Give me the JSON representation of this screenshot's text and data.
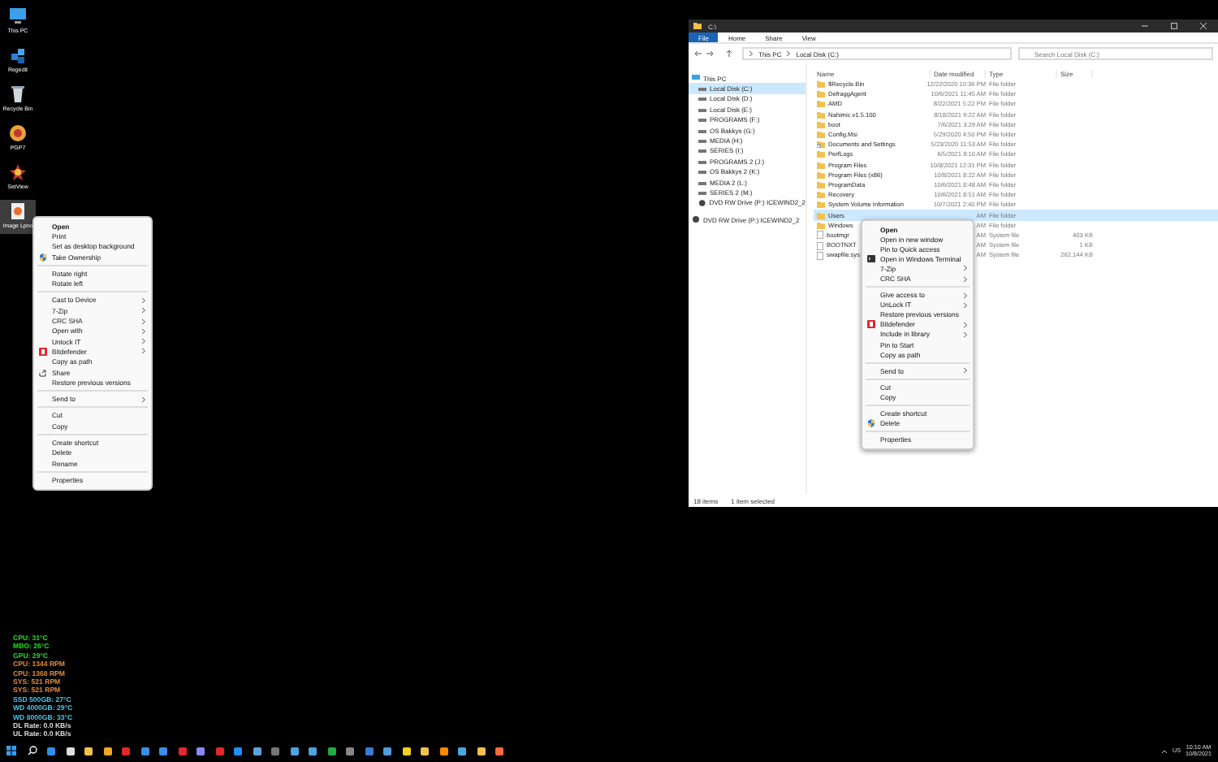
{
  "desktop_icons": [
    {
      "label": "This PC",
      "kind": "pc",
      "selected": false
    },
    {
      "label": "Regedit",
      "kind": "regedit",
      "selected": false
    },
    {
      "label": "Recycle Bin",
      "kind": "bin",
      "selected": false
    },
    {
      "label": "PGP7",
      "kind": "app",
      "selected": false
    },
    {
      "label": "SetView",
      "kind": "app2",
      "selected": false
    },
    {
      "label": "Image Lpno",
      "kind": "image",
      "selected": true
    }
  ],
  "desktop_menu": [
    {
      "kind": "item",
      "label": "Open",
      "bold": true
    },
    {
      "kind": "item",
      "label": "Print"
    },
    {
      "kind": "item",
      "label": "Set as desktop background"
    },
    {
      "kind": "item",
      "label": "Take Ownership"
    },
    {
      "kind": "separator"
    },
    {
      "kind": "item",
      "label": "Rotate right"
    },
    {
      "kind": "item",
      "label": "Rotate left"
    },
    {
      "kind": "separator"
    },
    {
      "kind": "item",
      "label": "Cast to Device",
      "submenu": true
    },
    {
      "kind": "item",
      "label": "7-Zip",
      "submenu": true
    },
    {
      "kind": "item",
      "label": "CRC SHA",
      "submenu": true
    },
    {
      "kind": "item",
      "label": "Open with",
      "submenu": true
    },
    {
      "kind": "item",
      "label": "Unlock IT",
      "submenu": true
    },
    {
      "kind": "item",
      "label": "Bitdefender",
      "submenu": true
    },
    {
      "kind": "item",
      "label": "Copy as path"
    },
    {
      "kind": "item",
      "label": "Share"
    },
    {
      "kind": "item",
      "label": "Restore previous versions"
    },
    {
      "kind": "separator"
    },
    {
      "kind": "item",
      "label": "Send to",
      "submenu": true
    },
    {
      "kind": "separator"
    },
    {
      "kind": "item",
      "label": "Cut"
    },
    {
      "kind": "item",
      "label": "Copy"
    },
    {
      "kind": "separator"
    },
    {
      "kind": "item",
      "label": "Create shortcut"
    },
    {
      "kind": "item",
      "label": "Delete"
    },
    {
      "kind": "item",
      "label": "Rename"
    },
    {
      "kind": "separator"
    },
    {
      "kind": "item",
      "label": "Properties"
    }
  ],
  "explorer": {
    "title": "C:\\",
    "ribbon_tabs": [
      {
        "label": "File",
        "selected": true
      },
      {
        "label": "Home",
        "selected": false
      },
      {
        "label": "Share",
        "selected": false
      },
      {
        "label": "View",
        "selected": false
      }
    ],
    "address": [
      "This PC",
      "Local Disk (C:)"
    ],
    "search": {
      "placeholder": "Search Local Disk (C:)"
    },
    "nav": [
      {
        "label": "This PC",
        "kind": "pc",
        "selected": false,
        "children": [
          {
            "label": "Local Disk (C:)",
            "kind": "drive",
            "selected": true
          },
          {
            "label": "Local Disk (D:)",
            "kind": "drive",
            "selected": false
          },
          {
            "label": "Local Disk (E:)",
            "kind": "drive",
            "selected": false
          },
          {
            "label": "PROGRAMS (F:)",
            "kind": "drive",
            "selected": false
          },
          {
            "label": "OS Bakkys (G:)",
            "kind": "drive",
            "selected": false
          },
          {
            "label": "MEDIA (H:)",
            "kind": "drive",
            "selected": false
          },
          {
            "label": "SERIES (I:)",
            "kind": "drive",
            "selected": false
          },
          {
            "label": "PROGRAMS 2 (J:)",
            "kind": "drive",
            "selected": false
          },
          {
            "label": "OS Bakkys 2 (K:)",
            "kind": "drive",
            "selected": false
          },
          {
            "label": "MEDIA 2 (L:)",
            "kind": "drive",
            "selected": false
          },
          {
            "label": "SERIES 2 (M:)",
            "kind": "drive",
            "selected": false
          },
          {
            "label": "DVD RW Drive (P:) ICEWIND2_2",
            "kind": "dvd",
            "selected": false
          }
        ]
      },
      {
        "label": "DVD RW Drive (P:) ICEWIND2_2",
        "kind": "dvd",
        "selected": false
      }
    ],
    "columns": [
      "Name",
      "Date modified",
      "Type",
      "Size"
    ],
    "rows": [
      {
        "kind": "folder",
        "selected": false,
        "cells": [
          "$Recycle.Bin",
          "12/22/2020 10:36 PM",
          "File folder",
          ""
        ]
      },
      {
        "kind": "folder",
        "selected": false,
        "cells": [
          "DefraggAgent",
          "10/6/2021 11:45 AM",
          "File folder",
          ""
        ]
      },
      {
        "kind": "folder",
        "selected": false,
        "cells": [
          "AMD",
          "8/22/2021 5:22 PM",
          "File folder",
          ""
        ]
      },
      {
        "kind": "folder",
        "selected": false,
        "cells": [
          "Nahimic v1.5.100",
          "8/18/2021 9:22 AM",
          "File folder",
          ""
        ]
      },
      {
        "kind": "folder",
        "selected": false,
        "cells": [
          "boot",
          "7/6/2021 3:29 AM",
          "File folder",
          ""
        ]
      },
      {
        "kind": "folder",
        "selected": false,
        "cells": [
          "Config.Msi",
          "5/29/2020 4:50 PM",
          "File folder",
          ""
        ]
      },
      {
        "kind": "link",
        "selected": false,
        "cells": [
          "Documents and Settings",
          "5/23/2020 11:53 AM",
          "File folder",
          ""
        ]
      },
      {
        "kind": "folder",
        "selected": false,
        "cells": [
          "PerfLogs",
          "6/5/2021 8:10 AM",
          "File folder",
          ""
        ]
      },
      {
        "kind": "folder",
        "selected": false,
        "cells": [
          "Program Files",
          "10/8/2021 12:31 PM",
          "File folder",
          ""
        ]
      },
      {
        "kind": "folder",
        "selected": false,
        "cells": [
          "Program Files (x86)",
          "10/8/2021 8:22 AM",
          "File folder",
          ""
        ]
      },
      {
        "kind": "folder",
        "selected": false,
        "cells": [
          "ProgramData",
          "10/6/2021 8:48 AM",
          "File folder",
          ""
        ]
      },
      {
        "kind": "folder",
        "selected": false,
        "cells": [
          "Recovery",
          "10/6/2021 8:51 AM",
          "File folder",
          ""
        ]
      },
      {
        "kind": "folder",
        "selected": false,
        "cells": [
          "System Volume Information",
          "10/7/2021 2:40 PM",
          "File folder",
          ""
        ]
      },
      {
        "kind": "folder",
        "selected": true,
        "cells": [
          "Users",
          "AM",
          "File folder",
          ""
        ]
      },
      {
        "kind": "folder",
        "selected": false,
        "cells": [
          "Windows",
          "AM",
          "File folder",
          ""
        ]
      },
      {
        "kind": "file",
        "selected": false,
        "cells": [
          "bootmgr",
          "AM",
          "System file",
          "403 KB"
        ]
      },
      {
        "kind": "file",
        "selected": false,
        "cells": [
          "BOOTNXT",
          "AM",
          "System file",
          "1 KB"
        ]
      },
      {
        "kind": "file",
        "selected": false,
        "cells": [
          "swapfile.sys",
          "AM",
          "System file",
          "262,144 KB"
        ]
      }
    ],
    "status": [
      "18 items",
      "1 item selected"
    ],
    "menu": [
      {
        "kind": "item",
        "label": "Open",
        "bold": true
      },
      {
        "kind": "item",
        "label": "Open in new window"
      },
      {
        "kind": "item",
        "label": "Pin to Quick access"
      },
      {
        "kind": "item",
        "label": "Open in Windows Terminal"
      },
      {
        "kind": "item",
        "label": "7-Zip",
        "submenu": true
      },
      {
        "kind": "item",
        "label": "CRC SHA",
        "submenu": true
      },
      {
        "kind": "separator"
      },
      {
        "kind": "item",
        "label": "Give access to",
        "submenu": true
      },
      {
        "kind": "item",
        "label": "UnLock IT",
        "submenu": true
      },
      {
        "kind": "item",
        "label": "Restore previous versions"
      },
      {
        "kind": "item",
        "label": "Bitdefender",
        "submenu": true
      },
      {
        "kind": "item",
        "label": "Include in library",
        "submenu": true
      },
      {
        "kind": "item",
        "label": "Pin to Start"
      },
      {
        "kind": "item",
        "label": "Copy as path"
      },
      {
        "kind": "separator"
      },
      {
        "kind": "item",
        "label": "Send to",
        "submenu": true
      },
      {
        "kind": "separator"
      },
      {
        "kind": "item",
        "label": "Cut"
      },
      {
        "kind": "item",
        "label": "Copy"
      },
      {
        "kind": "separator"
      },
      {
        "kind": "item",
        "label": "Create shortcut"
      },
      {
        "kind": "item",
        "label": "Delete"
      },
      {
        "kind": "separator"
      },
      {
        "kind": "item",
        "label": "Properties"
      }
    ]
  },
  "sensors": [
    {
      "text": "CPU: 31°C",
      "color": "#22dd22"
    },
    {
      "text": "MBO: 26°C",
      "color": "#22dd22"
    },
    {
      "text": "GPU: 29°C",
      "color": "#22dd22"
    },
    {
      "text": "CPU: 1344 RPM",
      "color": "#e08a3c"
    },
    {
      "text": "CPU: 1368 RPM",
      "color": "#e08a3c"
    },
    {
      "text": "SYS: 521 RPM",
      "color": "#e08a3c"
    },
    {
      "text": "SYS: 521 RPM",
      "color": "#e08a3c"
    },
    {
      "text": "SSD 500GB: 27°C",
      "color": "#4fc3e8"
    },
    {
      "text": "WD 4000GB: 29°C",
      "color": "#4fc3e8"
    },
    {
      "text": "WD 8000GB: 33°C",
      "color": "#4fc3e8"
    },
    {
      "text": "DL Rate: 0.0 KB/s",
      "color": "#dddddd"
    },
    {
      "text": "UL Rate: 0.0 KB/s",
      "color": "#dddddd"
    }
  ],
  "taskbar": {
    "apps": [
      {
        "color": "#2f8fe8"
      },
      {
        "color": "#dddddd"
      },
      {
        "color": "#f2c14e"
      },
      {
        "color": "#f5a623"
      },
      {
        "color": "#e0282e"
      },
      {
        "color": "#3a8ee6"
      },
      {
        "color": "#3a8ee6"
      },
      {
        "color": "#e0282e"
      },
      {
        "color": "#8888ff"
      },
      {
        "color": "#e0282e"
      },
      {
        "color": "#1e90ff"
      },
      {
        "color": "#5da0e0"
      },
      {
        "color": "#777777"
      },
      {
        "color": "#4fa3e0"
      },
      {
        "color": "#4fa3e0"
      },
      {
        "color": "#22aa44"
      },
      {
        "color": "#888888"
      },
      {
        "color": "#3a7bd5"
      },
      {
        "color": "#5599dd"
      },
      {
        "color": "#f5d020"
      },
      {
        "color": "#f2c14e"
      },
      {
        "color": "#ff8800"
      },
      {
        "color": "#44aadd"
      },
      {
        "color": "#f2c14e"
      },
      {
        "color": "#ff6a3c"
      }
    ],
    "tray_language": "US",
    "clock_time": "10:10 AM",
    "clock_date": "10/8/2021"
  }
}
